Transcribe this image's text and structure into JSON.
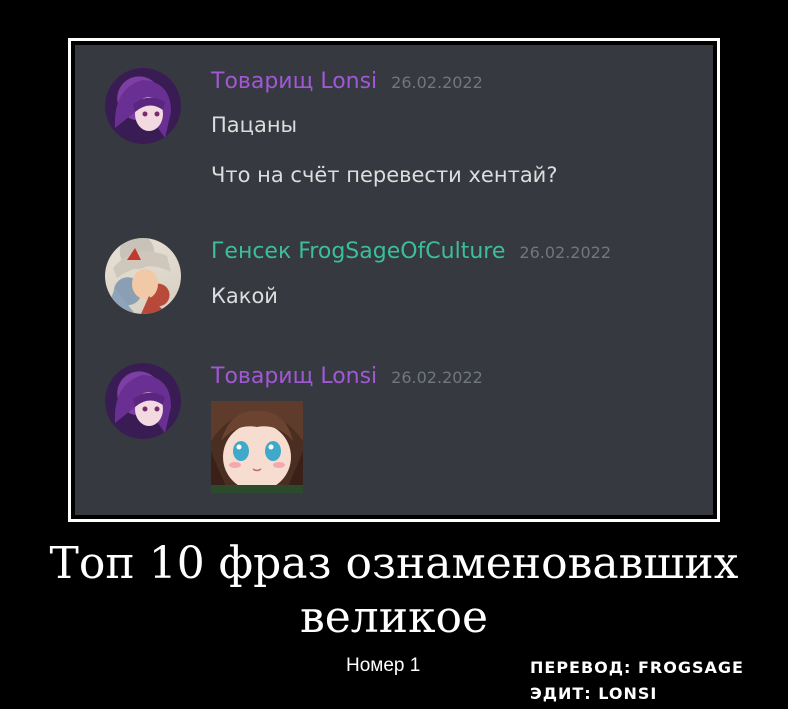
{
  "colors": {
    "lonsi_name": "#a158d6",
    "frog_name": "#3bbf9a",
    "chat_bg": "#36393f",
    "timestamp": "#72767d",
    "message_text": "#dcddde"
  },
  "messages": [
    {
      "author": "Товарищ Lonsi",
      "timestamp": "26.02.2022",
      "lines": [
        "Пацаны",
        "Что на счёт перевести хентай?"
      ]
    },
    {
      "author": "Генсек FrogSageOfCulture",
      "timestamp": "26.02.2022",
      "lines": [
        "Какой"
      ]
    },
    {
      "author": "Товарищ Lonsi",
      "timestamp": "26.02.2022",
      "attachment": "anime-girl-image"
    }
  ],
  "caption": {
    "line1": "Топ 10 фраз ознаменовавших",
    "line2": "великое",
    "subtitle": "Номер 1"
  },
  "credits": {
    "translation": "ПЕРЕВОД: FROGSAGE",
    "edit": "ЭДИТ: LONSI"
  }
}
